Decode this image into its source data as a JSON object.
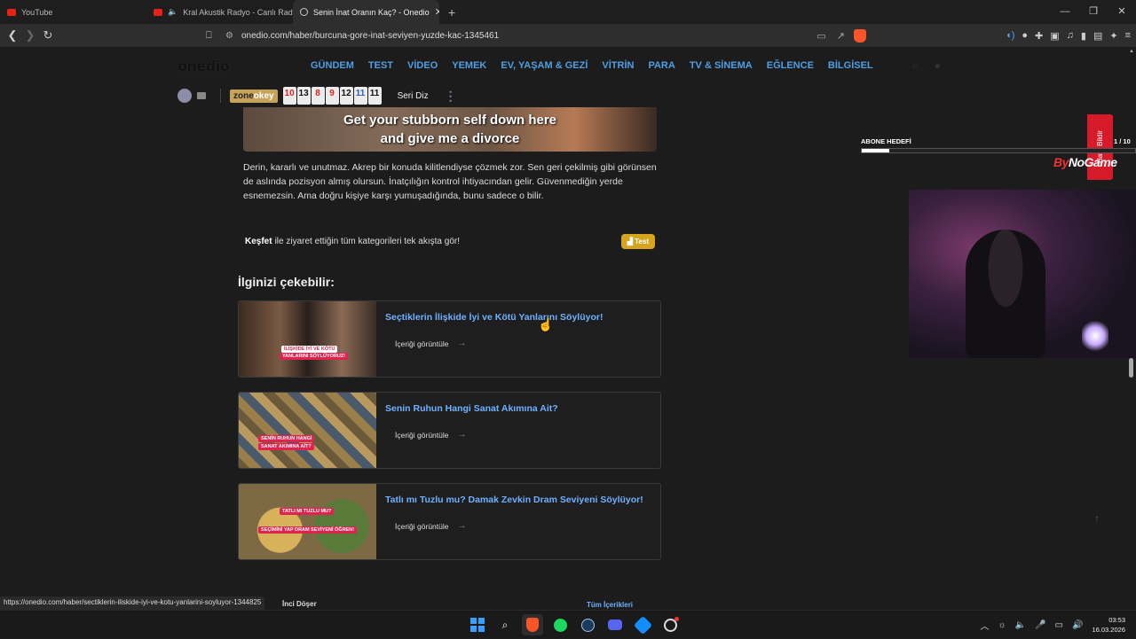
{
  "tabs": [
    {
      "title": "YouTube",
      "type": "yt"
    },
    {
      "title": "Kral Akustik Radyo - Canlı Radyo",
      "type": "yt"
    },
    {
      "title": "Senin İnat Oranın Kaç? - Onedio",
      "type": "web"
    }
  ],
  "tab_close": "✕",
  "new_tab": "+",
  "window_controls": [
    "—",
    "❐",
    "✕"
  ],
  "nav": {
    "back": "❮",
    "forward": "❯",
    "reload": "↻"
  },
  "address": {
    "url": "onedio.com/haber/burcuna-gore-inat-seviyen-yuzde-kac-1345461"
  },
  "site": {
    "logo": "onedio",
    "menu": [
      "GÜNDEM",
      "TEST",
      "VİDEO",
      "YEMEK",
      "EV, YAŞAM & GEZİ",
      "VİTRİN",
      "PARA",
      "TV & SİNEMA",
      "EĞLENCE",
      "BİLGİSEL"
    ]
  },
  "subbar": {
    "zone_a": "zone",
    "zone_b": "okey",
    "tiles": [
      {
        "n": "10",
        "c": "red"
      },
      {
        "n": "13",
        "c": "blk"
      },
      {
        "n": "8",
        "c": "red"
      },
      {
        "n": "9",
        "c": "red"
      },
      {
        "n": "12",
        "c": "blk"
      },
      {
        "n": "11",
        "c": "blu"
      },
      {
        "n": "11",
        "c": "blk"
      }
    ],
    "seri": "Seri Diz"
  },
  "hero": {
    "line1": "Get your stubborn self down here",
    "line2": "and give me a divorce"
  },
  "paragraph": "Derin, kararlı ve unutmaz. Akrep bir konuda kilitlendiyse çözmek zor. Sen geri çekilmiş gibi görünsen de aslında pozisyon almış olursun. İnatçılığın kontrol ihtiyacından gelir. Güvenmediğin yerde esnemezsin. Ama doğru kişiye karşı yumuşadığında, bunu sadece o bilir.",
  "kesfet": {
    "bold": "Keşfet",
    "text": "ile ziyaret ettiğin tüm kategorileri tek akışta gör!",
    "button": "Test"
  },
  "related_heading": "İlginizi çekebilir:",
  "cards": [
    {
      "title": "Seçtiklerin İlişkide İyi ve Kötü Yanlarını Söylüyor!",
      "view": "İçeriği görüntüle",
      "badge1": "İLİŞKİDE İYİ VE KÖTÜ",
      "badge2": "YANLARINI SÖYLÜYORUZ!"
    },
    {
      "title": "Senin Ruhun Hangi Sanat Akımına Ait?",
      "view": "İçeriği görüntüle",
      "badge1": "SENİN RUHUN HANGİ",
      "badge2": "SANAT AKIMINA AİT?"
    },
    {
      "title": "Tatlı mı Tuzlu mu? Damak Zevkin Dram Seviyeni Söylüyor!",
      "view": "İçeriği görüntüle",
      "badge1": "TATLI MI TUZLU MU?",
      "badge2": "SEÇİMİNİ YAP DRAM SEVİYENİ ÖĞREN!"
    }
  ],
  "overlay": {
    "abone": "ABONE HEDEFİ",
    "count": "1 / 10",
    "progress": 0.1,
    "bildir": "Hata Bildir",
    "bynogame_by": "By",
    "bynogame_rest": "NoGame"
  },
  "status_url": "https://onedio.com/haber/sectiklerin-iliskide-iyi-ve-kotu-yanlarini-soyluyor-1344825",
  "footer": {
    "inci": "İnci Döşer",
    "tum": "Tüm İçerikleri"
  },
  "clock": {
    "time": "03:53",
    "date": "16.03.2026"
  }
}
